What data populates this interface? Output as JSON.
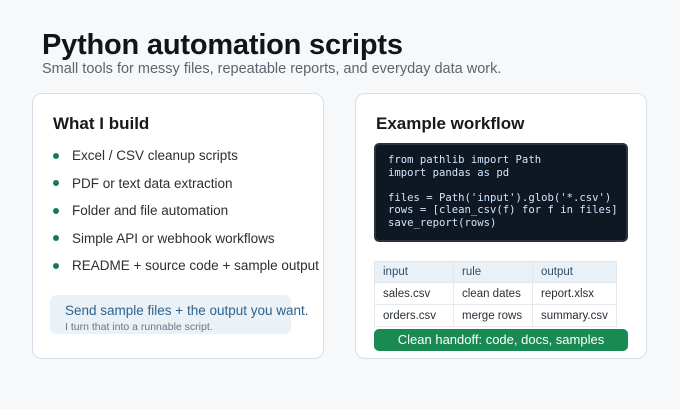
{
  "header": {
    "title": "Python automation scripts",
    "subtitle": "Small tools for messy files, repeatable reports, and everyday data work."
  },
  "build_card": {
    "heading": "What I build",
    "items": [
      "Excel / CSV cleanup scripts",
      "PDF or text data extraction",
      "Folder and file automation",
      "Simple API or webhook workflows",
      "README + source code + sample output"
    ],
    "cta_main": "Send sample files + the output you want.",
    "cta_sub": "I turn that into a runnable script."
  },
  "workflow_card": {
    "heading": "Example workflow",
    "code_lines": [
      "from pathlib import Path",
      "import pandas as pd",
      "",
      "files = Path('input').glob('*.csv')",
      "rows = [clean_csv(f) for f in files]",
      "save_report(rows)"
    ],
    "table": {
      "headers": [
        "input",
        "rule",
        "output"
      ],
      "rows": [
        [
          "sales.csv",
          "clean dates",
          "report.xlsx"
        ],
        [
          "orders.csv",
          "merge rows",
          "summary.csv"
        ]
      ]
    },
    "handoff_label": "Clean handoff: code, docs, samples"
  },
  "colors": {
    "accent_green": "#1a8a53",
    "bullet_green": "#18794e",
    "cta_blue": "#2b6391",
    "code_bg": "#0f1722"
  }
}
